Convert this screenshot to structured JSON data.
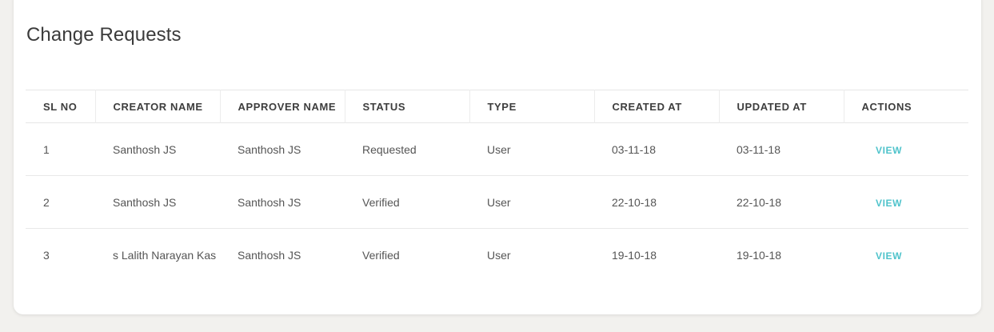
{
  "page": {
    "title": "Change Requests"
  },
  "table": {
    "columns": [
      "SL NO",
      "CREATOR NAME",
      "APPROVER NAME",
      "STATUS",
      "TYPE",
      "CREATED AT",
      "UPDATED AT",
      "ACTIONS"
    ],
    "rows": [
      {
        "sl_no": "1",
        "creator": "Santhosh JS",
        "approver": "Santhosh JS",
        "status": "Requested",
        "type": "User",
        "created_at": "03-11-18",
        "updated_at": "03-11-18",
        "action": "VIEW"
      },
      {
        "sl_no": "2",
        "creator": "Santhosh JS",
        "approver": "Santhosh JS",
        "status": "Verified",
        "type": "User",
        "created_at": "22-10-18",
        "updated_at": "22-10-18",
        "action": "VIEW"
      },
      {
        "sl_no": "3",
        "creator": "s Lalith Narayan Kas",
        "approver": "Santhosh JS",
        "status": "Verified",
        "type": "User",
        "created_at": "19-10-18",
        "updated_at": "19-10-18",
        "action": "VIEW"
      }
    ]
  },
  "colors": {
    "accent": "#4fc3cb",
    "background": "#f2f1ee",
    "card": "#ffffff"
  }
}
